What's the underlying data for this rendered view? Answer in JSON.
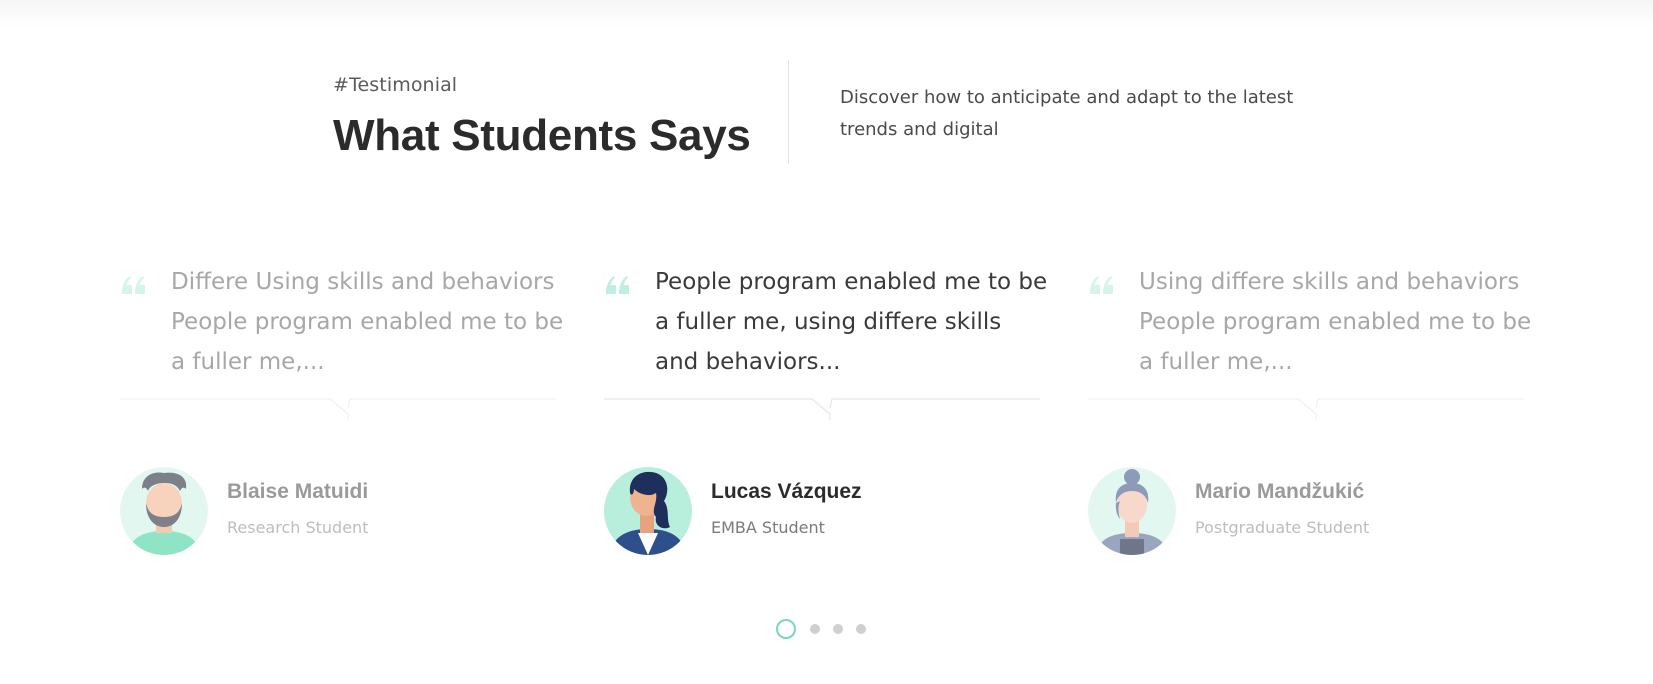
{
  "header": {
    "tag": "#Testimonial",
    "title": "What Students Says",
    "description": "Discover how to anticipate and adapt to the latest trends and digital"
  },
  "testimonials": [
    {
      "quote": "Differe Using skills and behaviors People program enabled me to be a fuller me,...",
      "name": "Blaise Matuidi",
      "role": "Research Student",
      "active": false
    },
    {
      "quote": "People program enabled me to be a fuller me, using differe skills and behaviors...",
      "name": "Lucas Vázquez",
      "role": "EMBA Student",
      "active": true
    },
    {
      "quote": "Using differe skills and behaviors People program enabled me to be a fuller me,...",
      "name": "Mario Mandžukić",
      "role": "Postgraduate Student",
      "active": false
    }
  ],
  "pagination": {
    "pages": 4,
    "active_index": 0
  },
  "colors": {
    "accent": "#7ad6c1",
    "quote_icon": "#d6f3ec",
    "text_dark": "#2b2b2b",
    "text_muted": "#a7a7a7"
  },
  "icons": [
    "quote-icon",
    "avatar-illustration"
  ]
}
